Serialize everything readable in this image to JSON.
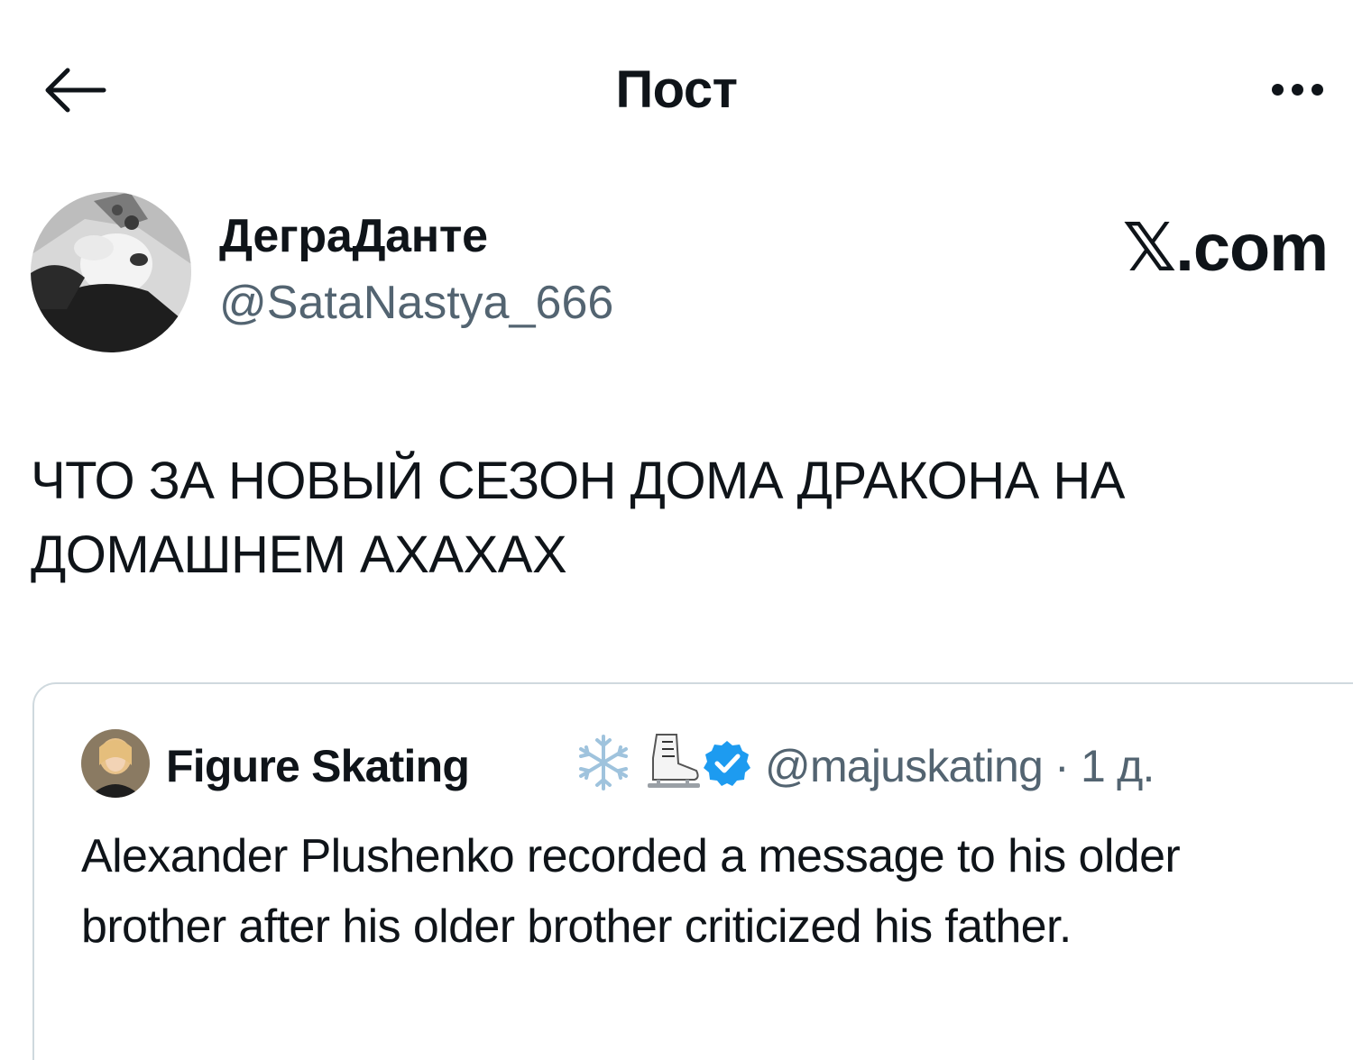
{
  "header": {
    "title": "Пост",
    "back_icon": "arrow-left-icon",
    "more_icon": "more-horizontal-icon"
  },
  "author": {
    "name": "ДеграДанте",
    "handle": "@SataNastya_666"
  },
  "watermark": "𝕏.com",
  "tweet": {
    "text": "ЧТО ЗА НОВЫЙ СЕЗОН ДОМА ДРАКОНА НА ДОМАШНЕМ АХАХАХ"
  },
  "quoted_tweet": {
    "name": "Figure Skating",
    "emojis": [
      "snowflake-icon",
      "ice-skate-icon"
    ],
    "verified_icon": "verified-badge-icon",
    "meta": "@majuskating · 1 д.",
    "text": "Alexander Plushenko recorded a message to his older brother after his older brother criticized his father."
  },
  "colors": {
    "text_primary": "#0f1419",
    "text_secondary": "#536471",
    "border": "#cfd9de",
    "verified_blue": "#1d9bf0"
  }
}
